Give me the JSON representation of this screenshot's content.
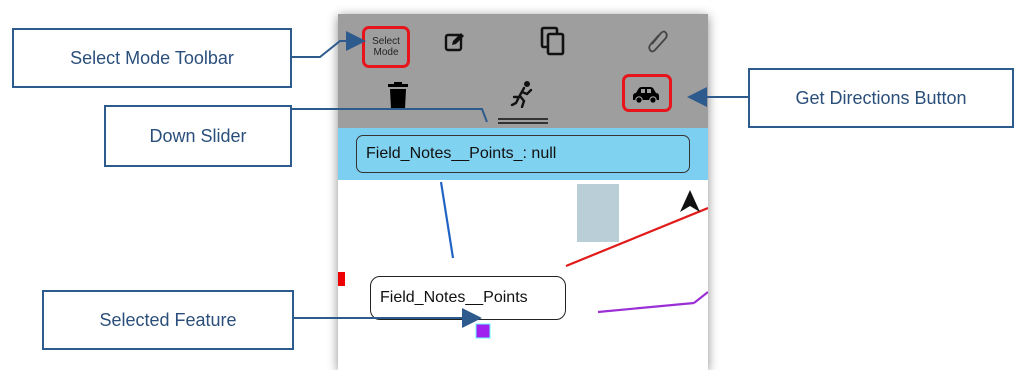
{
  "toolbar": {
    "select_mode_label": "Select\nMode",
    "icons": [
      "edit-icon",
      "copy-icon",
      "attachment-icon",
      "trash-icon",
      "walk-icon",
      "car-icon"
    ]
  },
  "attribute_field": {
    "text": "Field_Notes__Points_: null"
  },
  "map": {
    "callout_text": "Field_Notes__Points"
  },
  "annotations": {
    "select_mode_toolbar": "Select Mode Toolbar",
    "down_slider": "Down Slider",
    "selected_feature": "Selected Feature",
    "get_directions_button": "Get Directions Button"
  },
  "colors": {
    "annotation_border": "#2e5b8e",
    "annotation_text": "#2b4f7b",
    "highlight": "#e8141c",
    "toolbar_bg": "#9e9e9e",
    "band_bg": "#7ccff0",
    "selected_feature": "#a020f0"
  }
}
